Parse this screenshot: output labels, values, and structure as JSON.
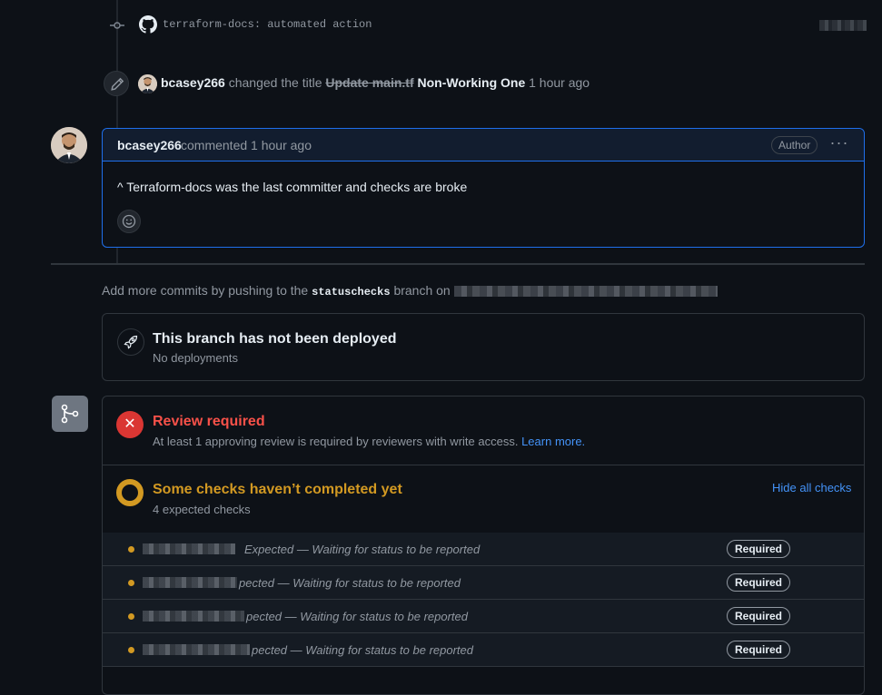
{
  "commit": {
    "message": "terraform-docs: automated action"
  },
  "title_change": {
    "user": "bcasey266",
    "action": "changed the title",
    "old_title": "Update main.tf",
    "new_title": "Non-Working One",
    "time": "1 hour ago"
  },
  "comment": {
    "user": "bcasey266",
    "meta": "commented 1 hour ago",
    "badge": "Author",
    "more": "···",
    "body": "^ Terraform-docs was the last committer and checks are broke"
  },
  "push_note": {
    "prefix": "Add more commits by pushing to the",
    "branch": "statuschecks",
    "suffix": "branch on"
  },
  "deployment": {
    "title": "This branch has not been deployed",
    "subtitle": "No deployments"
  },
  "review": {
    "title": "Review required",
    "subtitle": "At least 1 approving review is required by reviewers with write access.",
    "learn_more": "Learn more.",
    "icon": "x-icon"
  },
  "checks": {
    "title": "Some checks haven’t completed yet",
    "subtitle": "4 expected checks",
    "hide_link": "Hide all checks",
    "rows": [
      {
        "status": "Expected — Waiting for status to be reported",
        "badge": "Required"
      },
      {
        "status": "pected — Waiting for status to be reported",
        "badge": "Required"
      },
      {
        "status": "pected — Waiting for status to be reported",
        "badge": "Required"
      },
      {
        "status": "pected — Waiting for status to be reported",
        "badge": "Required"
      }
    ]
  },
  "colors": {
    "background": "#0d1117",
    "accent_blue": "#1f6feb",
    "danger": "#da3633",
    "warning": "#d29922",
    "link": "#4493f8"
  }
}
